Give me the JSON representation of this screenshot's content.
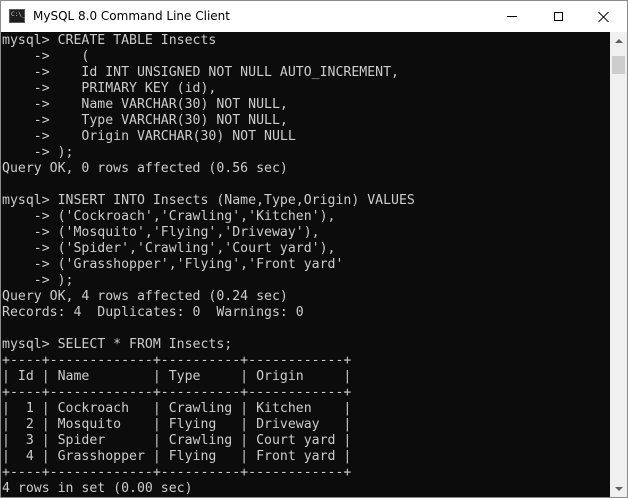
{
  "window": {
    "title": "MySQL 8.0 Command Line Client",
    "icon": "console-app-icon",
    "icon_text": "C:\\_"
  },
  "controls": {
    "minimize": "minimize-icon",
    "maximize": "maximize-icon",
    "close": "close-icon"
  },
  "console": {
    "lines": [
      "mysql> CREATE TABLE Insects",
      "    ->    (",
      "    ->    Id INT UNSIGNED NOT NULL AUTO_INCREMENT,",
      "    ->    PRIMARY KEY (id),",
      "    ->    Name VARCHAR(30) NOT NULL,",
      "    ->    Type VARCHAR(30) NOT NULL,",
      "    ->    Origin VARCHAR(30) NOT NULL",
      "    -> );",
      "Query OK, 0 rows affected (0.56 sec)",
      "",
      "mysql> INSERT INTO Insects (Name,Type,Origin) VALUES",
      "    -> ('Cockroach','Crawling','Kitchen'),",
      "    -> ('Mosquito','Flying','Driveway'),",
      "    -> ('Spider','Crawling','Court yard'),",
      "    -> ('Grasshopper','Flying','Front yard'",
      "    -> );",
      "Query OK, 4 rows affected (0.24 sec)",
      "Records: 4  Duplicates: 0  Warnings: 0",
      "",
      "mysql> SELECT * FROM Insects;",
      "+----+-------------+----------+------------+",
      "| Id | Name        | Type     | Origin     |",
      "+----+-------------+----------+------------+",
      "|  1 | Cockroach   | Crawling | Kitchen    |",
      "|  2 | Mosquito    | Flying   | Driveway   |",
      "|  3 | Spider      | Crawling | Court yard |",
      "|  4 | Grasshopper | Flying   | Front yard |",
      "+----+-------------+----------+------------+",
      "4 rows in set (0.00 sec)"
    ]
  },
  "colors": {
    "console_bg": "#0c0c0c",
    "console_fg": "#cccccc",
    "titlebar_bg": "#ffffff"
  }
}
